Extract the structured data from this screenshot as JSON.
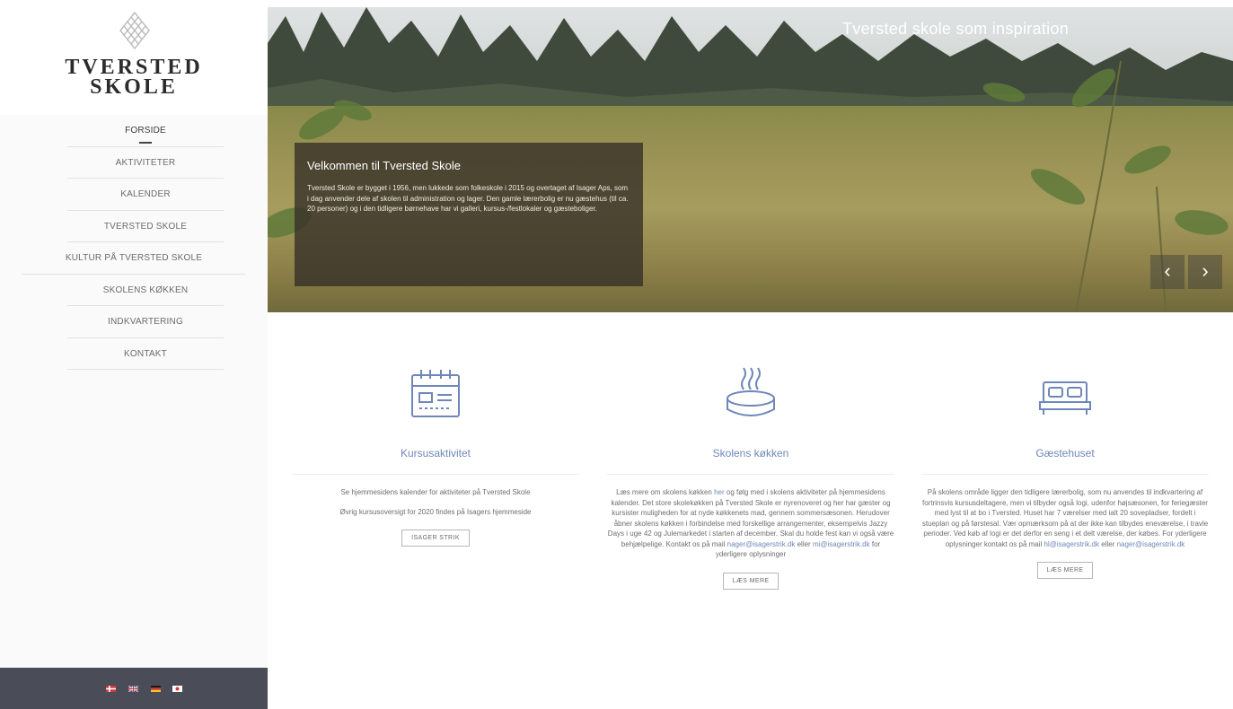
{
  "brand": {
    "name_line1": "TVERSTED",
    "name_line2": "SKOLE",
    "logo_icon": "knot-emblem-icon"
  },
  "nav": {
    "items": [
      {
        "label": "FORSIDE",
        "active": true
      },
      {
        "label": "AKTIVITETER"
      },
      {
        "label": "KALENDER"
      },
      {
        "label": "TVERSTED SKOLE"
      },
      {
        "label": "KULTUR PÅ TVERSTED SKOLE"
      },
      {
        "label": "SKOLENS KØKKEN"
      },
      {
        "label": "INDKVARTERING"
      },
      {
        "label": "KONTAKT"
      }
    ]
  },
  "languages": [
    "danish-flag-icon",
    "uk-flag-icon",
    "german-flag-icon",
    "japanese-flag-icon"
  ],
  "hero": {
    "caption": "Tversted skole som inspiration",
    "box_title": "Velkommen til Tversted Skole",
    "box_text": "Tversted Skole er bygget i 1956, men lukkede som folkeskole i 2015 og overtaget af Isager Aps, som i dag anvender dele af skolen til administration og lager. Den gamle lærerbolig er nu gæstehus (til ca. 20 personer) og i den tidligere børnehave har vi galleri, kursus-/festlokaler og gæsteboliger.",
    "prev_label": "‹",
    "next_label": "›"
  },
  "features": {
    "kursus": {
      "title": "Kursusaktivitet",
      "icon": "calendar-icon",
      "text1": "Se hjemmesidens kalender for aktiviteter på Tversted Skole",
      "text2": "Øvrig kursusoversigt for 2020 findes på Isagers hjemmeside",
      "button": "ISAGER STRIK"
    },
    "kokken": {
      "title": "Skolens køkken",
      "icon": "hot-dish-icon",
      "text_before": "Læs mere om skolens køkken ",
      "link_her": "her",
      "text_mid": " og følg med i skolens aktiviteter på hjemmesidens kalender. Det store skolekøkken på Tversted Skole er nyrenoveret og her har gæster og kursister muligheden for at nyde køkkenets mad, gennem sommersæsonen. Herudover åbner skolens køkken i forbindelse med forskellige arrangementer, eksempelvis Jazzy Days i uge 42 og Julemarkedet i starten af december. Skal du holde fest kan vi også være behjælpelige. Kontakt os på mail ",
      "email1": "nager@isagerstrik.dk",
      "text_or": " eller ",
      "email2": "mi@isagerstrik.dk",
      "text_end": " for yderligere oplysninger",
      "button": "LÆS MERE"
    },
    "gaestehus": {
      "title": "Gæstehuset",
      "icon": "bed-icon",
      "text_main": "På skolens område ligger den tidligere lærerbolig, som nu anvendes til indkvartering af fortrinsvis kursusdeltagere, men vi tilbyder også logi, udenfor højsæsonen, for feriegæster med lyst til at bo i Tversted. Huset har 7 værelser med ialt 20 sovepladser, fordelt i stueplan og på førstesal. Vær opmærksom på at der ikke kan tilbydes eneværelse, i travle perioder. Ved køb af logi er det derfor en seng i et delt værelse, der købes. For yderligere oplysninger kontakt os på mail ",
      "email1": "hl@isagerstrik.dk",
      "text_or": " eller ",
      "email2": "nager@isagerstrik.dk",
      "button": "LÆS MERE"
    }
  },
  "colors": {
    "accent": "#6f87b8",
    "sidebar_bottom": "#4a4d58",
    "hero_box": "#342e26"
  }
}
